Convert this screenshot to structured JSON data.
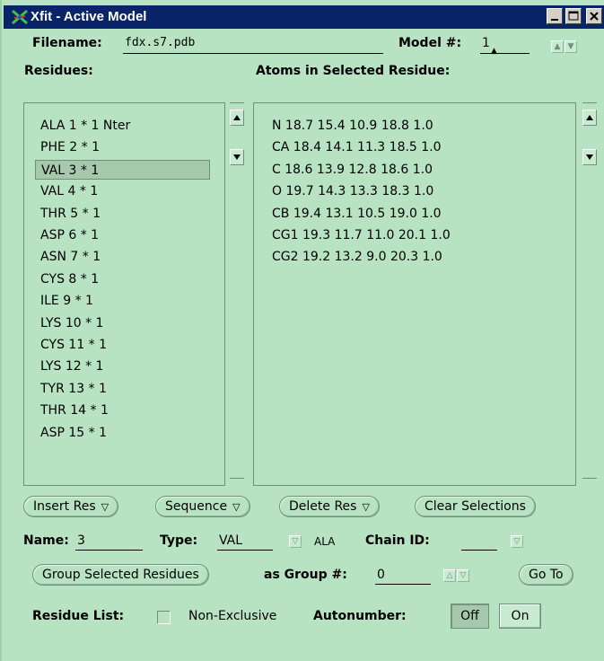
{
  "window": {
    "title": "Xfit - Active Model"
  },
  "header": {
    "filename_label": "Filename:",
    "filename_value": "fdx.s7.pdb",
    "model_label": "Model #:",
    "model_value": "1"
  },
  "residues": {
    "label": "Residues:",
    "items": [
      "ALA 1 * 1 Nter",
      "PHE 2 * 1",
      "VAL 3 * 1",
      "VAL 4 * 1",
      "THR 5 * 1",
      "ASP 6 * 1",
      "ASN 7 * 1",
      "CYS 8 * 1",
      "ILE 9 * 1",
      "LYS 10 * 1",
      "CYS 11 * 1",
      "LYS 12 * 1",
      "TYR 13 * 1",
      "THR 14 * 1",
      "ASP 15 * 1"
    ],
    "selected_index": 2
  },
  "atoms": {
    "label": "Atoms in Selected Residue:",
    "items": [
      "N 18.7 15.4 10.9 18.8 1.0",
      "CA 18.4 14.1 11.3 18.5 1.0",
      "C 18.6 13.9 12.8 18.6 1.0",
      "O 19.7 14.3 13.3 18.3 1.0",
      "CB 19.4 13.1 10.5 19.0 1.0",
      "CG1 19.3 11.7 11.0 20.1 1.0",
      "CG2 19.2 13.2 9.0 20.3 1.0"
    ]
  },
  "buttons": {
    "insert_res": "Insert Res",
    "sequence": "Sequence",
    "delete_res": "Delete Res",
    "clear_selections": "Clear Selections",
    "group_selected": "Group Selected Residues",
    "go_to": "Go To"
  },
  "fields": {
    "name_label": "Name:",
    "name_value": "3",
    "type_label": "Type:",
    "type_value": "VAL",
    "type_hint": "ALA",
    "chain_label": "Chain ID:",
    "chain_value": "",
    "group_label": "as Group #:",
    "group_value": "0"
  },
  "options": {
    "residue_list_label": "Residue List:",
    "non_exclusive_label": "Non-Exclusive",
    "non_exclusive_checked": false,
    "autonumber_label": "Autonumber:",
    "off_label": "Off",
    "on_label": "On",
    "autonumber_selected": "Off"
  }
}
